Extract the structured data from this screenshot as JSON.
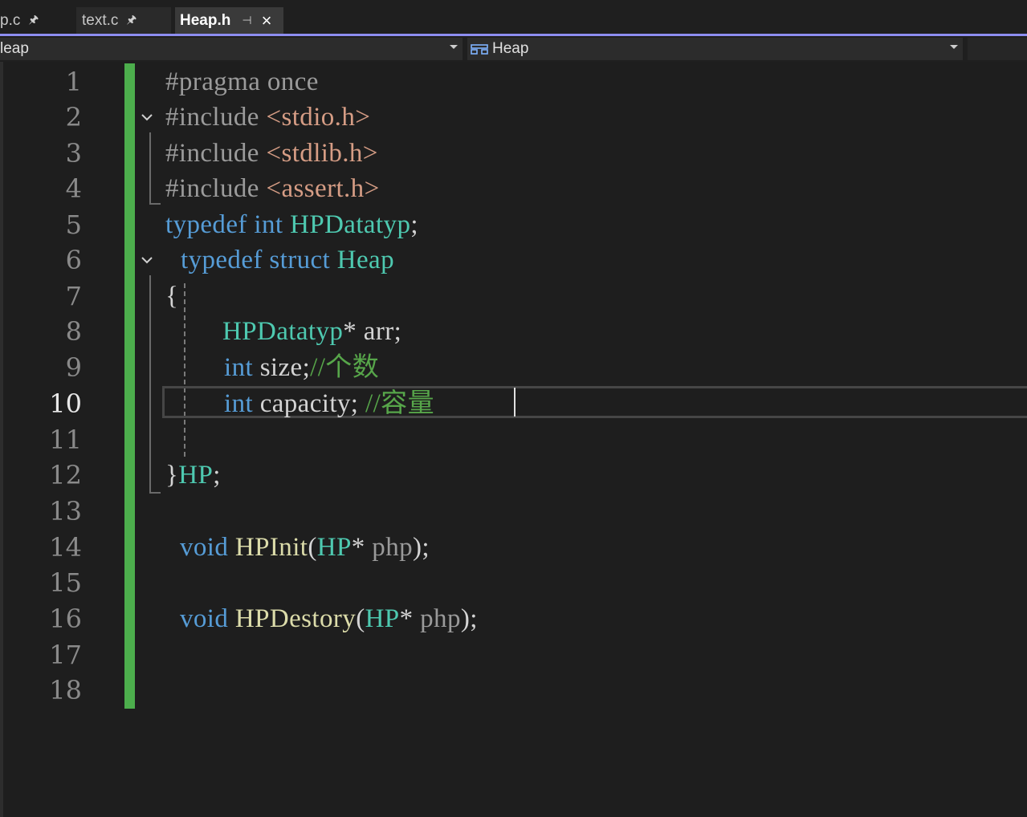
{
  "tabs": [
    {
      "label": "p.c",
      "pinned": true,
      "active": false
    },
    {
      "label": "text.c",
      "pinned": true,
      "active": false
    },
    {
      "label": "Heap.h",
      "pinned": true,
      "active": true,
      "closable": true
    }
  ],
  "nav": {
    "left_dropdown": "leap",
    "right_dropdown": "Heap"
  },
  "editor": {
    "current_line": 10,
    "line_numbers": [
      "1",
      "2",
      "3",
      "4",
      "5",
      "6",
      "7",
      "8",
      "9",
      "10",
      "11",
      "12",
      "13",
      "14",
      "15",
      "16",
      "17",
      "18"
    ],
    "lines": [
      [
        {
          "t": "#pragma once",
          "c": "pp"
        }
      ],
      [
        {
          "t": "#include ",
          "c": "pp"
        },
        {
          "t": "<stdio.h>",
          "c": "str"
        }
      ],
      [
        {
          "t": "#include ",
          "c": "pp"
        },
        {
          "t": "<stdlib.h>",
          "c": "str"
        }
      ],
      [
        {
          "t": "#include ",
          "c": "pp"
        },
        {
          "t": "<assert.h>",
          "c": "str"
        }
      ],
      [
        {
          "t": "typedef ",
          "c": "kw"
        },
        {
          "t": "int ",
          "c": "kw"
        },
        {
          "t": "HPDatatyp",
          "c": "ty"
        },
        {
          "t": ";",
          "c": "pl"
        }
      ],
      [
        {
          "t": "typedef ",
          "c": "kw"
        },
        {
          "t": "struct ",
          "c": "kw"
        },
        {
          "t": "Heap",
          "c": "ty"
        }
      ],
      [
        {
          "t": "{",
          "c": "pl"
        }
      ],
      [
        {
          "t": "HPDatatyp",
          "c": "ty"
        },
        {
          "t": "* arr;",
          "c": "pl"
        }
      ],
      [
        {
          "t": "int ",
          "c": "kw"
        },
        {
          "t": "size;",
          "c": "pl"
        },
        {
          "t": "//个数",
          "c": "cm"
        }
      ],
      [
        {
          "t": "int ",
          "c": "kw"
        },
        {
          "t": "capacity; ",
          "c": "pl"
        },
        {
          "t": "//容量",
          "c": "cm"
        }
      ],
      [],
      [
        {
          "t": "}",
          "c": "pl"
        },
        {
          "t": "HP",
          "c": "ty"
        },
        {
          "t": ";",
          "c": "pl"
        }
      ],
      [],
      [
        {
          "t": "void ",
          "c": "kw"
        },
        {
          "t": "HPInit",
          "c": "fn"
        },
        {
          "t": "(",
          "c": "pl"
        },
        {
          "t": "HP",
          "c": "ty"
        },
        {
          "t": "* ",
          "c": "pl"
        },
        {
          "t": "php",
          "c": "par"
        },
        {
          "t": ");",
          "c": "pl"
        }
      ],
      [],
      [
        {
          "t": "void ",
          "c": "kw"
        },
        {
          "t": "HPDestory",
          "c": "fn"
        },
        {
          "t": "(",
          "c": "pl"
        },
        {
          "t": "HP",
          "c": "ty"
        },
        {
          "t": "* ",
          "c": "pl"
        },
        {
          "t": "php",
          "c": "par"
        },
        {
          "t": ");",
          "c": "pl"
        }
      ],
      [],
      []
    ]
  },
  "colors": {
    "background": "#1e1e1e",
    "keyword": "#569cd6",
    "type": "#4ec9b0",
    "function": "#dcdcaa",
    "string": "#d69d85",
    "comment": "#57a64a",
    "preprocessor": "#9b9b9b",
    "change_bar": "#4cae4c",
    "tab_accent": "#8d8df0"
  }
}
